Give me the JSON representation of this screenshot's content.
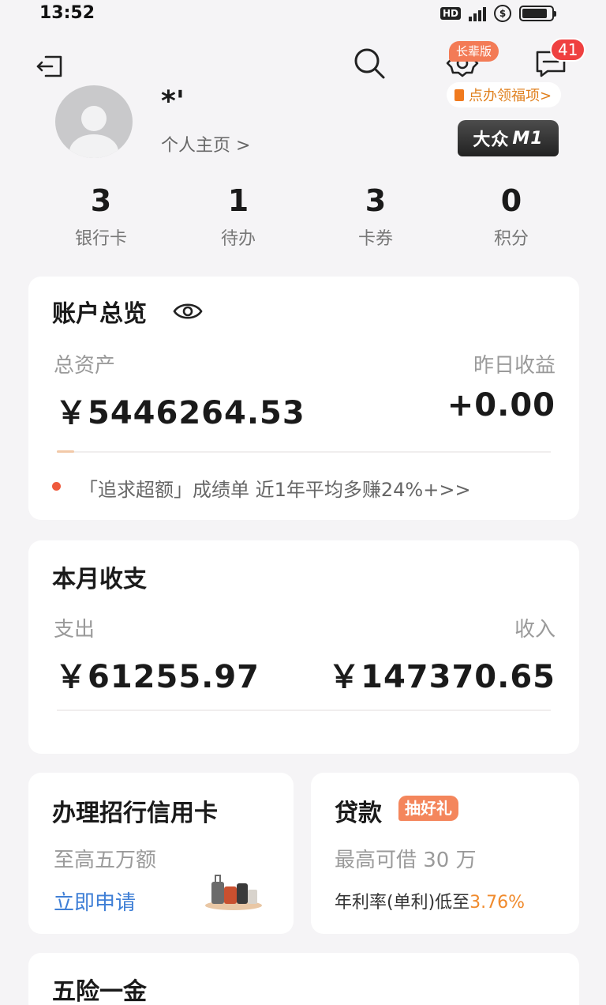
{
  "status_bar": {
    "time": "13:52",
    "hd": "HD"
  },
  "header": {
    "promo_tag": "长辈版",
    "message_count": "41",
    "welfare_link": "点办领福项>"
  },
  "profile": {
    "name": "*'",
    "homepage_link": "个人主页 >",
    "level_prefix": "大众",
    "level_code": "M1"
  },
  "stats": [
    {
      "value": "3",
      "label": "银行卡"
    },
    {
      "value": "1",
      "label": "待办"
    },
    {
      "value": "3",
      "label": "卡券"
    },
    {
      "value": "0",
      "label": "积分"
    }
  ],
  "account_overview": {
    "title": "账户总览",
    "total_assets_label": "总资产",
    "total_assets": "￥5446264.53",
    "yesterday_income_label": "昨日收益",
    "yesterday_income": "+0.00",
    "promo_text": "「追求超额」成绩单 近1年平均多赚24%+>>"
  },
  "monthly": {
    "title": "本月收支",
    "expense_label": "支出",
    "expense": "￥61255.97",
    "income_label": "收入",
    "income": "￥147370.65"
  },
  "credit_card": {
    "title": "办理招行信用卡",
    "subtitle": "至高五万额",
    "apply": "立即申请"
  },
  "loan": {
    "title": "贷款",
    "tag": "抽好礼",
    "subtitle": "最高可借 30 万",
    "rate_prefix": "年利率(单利)低至",
    "rate_value": "3.76%"
  },
  "insurance": {
    "title": "五险一金"
  },
  "colors": {
    "accent": "#f37b56",
    "badge": "#ef4040",
    "link": "#3f7fd6",
    "rate": "#f08a2c"
  }
}
